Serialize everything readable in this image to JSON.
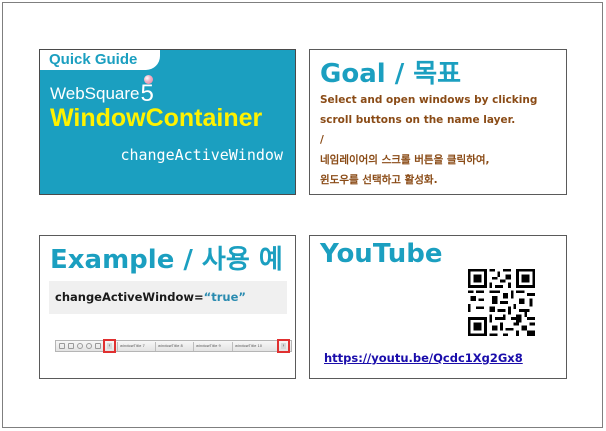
{
  "quick_guide": {
    "tab_label": "Quick Guide",
    "brand_name": "WebSquare",
    "brand_version": "5",
    "title": "WindowContainer",
    "function_name": "changeActiveWindow"
  },
  "goal": {
    "title": "Goal / 목표",
    "lines": [
      "Select and open windows by clicking",
      "scroll buttons on the name layer.",
      "/",
      "네임레이어의 스크롤 버튼을 클릭하여,",
      "윈도우를 선택하고 활성화."
    ]
  },
  "example": {
    "title": "Example / 사용 예",
    "code_attr": "changeActiveWindow=",
    "code_value": "“true”",
    "toolbar_tabs": [
      "windowTitle 7",
      "windowTitle 8",
      "windowTitle 9",
      "windowTitle 10"
    ],
    "left_scroll_glyph": "‹",
    "right_scroll_glyph": "›"
  },
  "youtube": {
    "title": "YouTube",
    "qr_icon": "qr-code-icon",
    "link_text": "https://youtu.be/Qcdc1Xg2Gx8"
  },
  "colors": {
    "accent": "#1b9fc0",
    "highlight_yellow": "#fff200",
    "goal_text": "#8a4b16",
    "link": "#1a0dab",
    "scroll_box": "#e03030"
  }
}
